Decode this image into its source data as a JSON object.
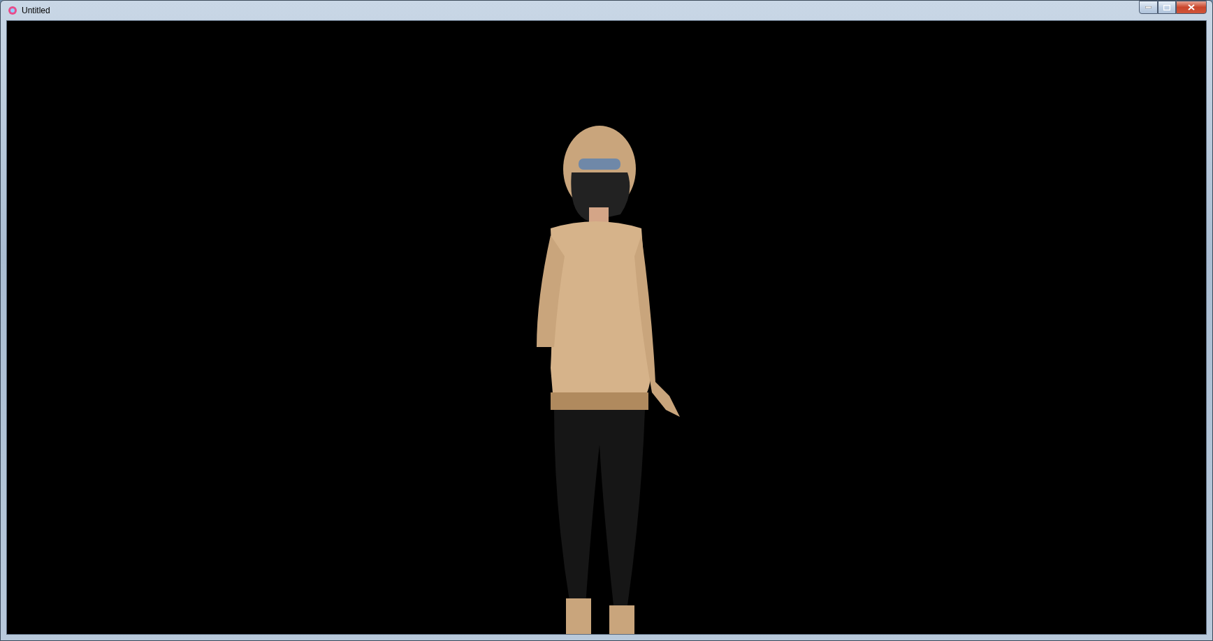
{
  "window": {
    "title": "Untitled"
  }
}
